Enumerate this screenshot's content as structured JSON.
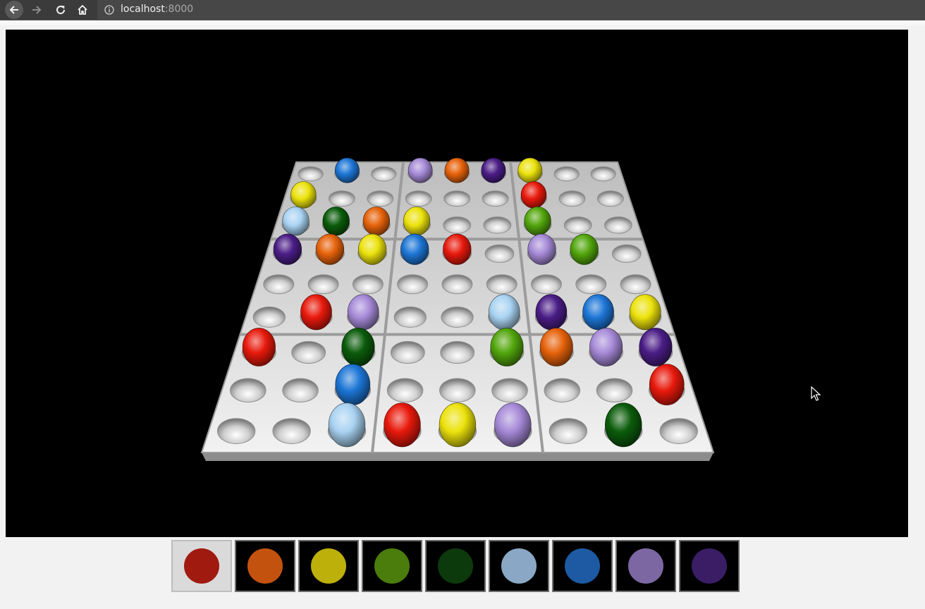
{
  "browser": {
    "url_host": "localhost",
    "url_port": ":8000"
  },
  "board": {
    "grid": [
      [
        "",
        "blue",
        "",
        "lavender",
        "orange",
        "purple",
        "yellow",
        "",
        ""
      ],
      [
        "yellow",
        "",
        "",
        "",
        "",
        "",
        "red",
        "",
        ""
      ],
      [
        "lightblue",
        "darkgreen",
        "orange",
        "yellow",
        "",
        "",
        "green",
        "",
        ""
      ],
      [
        "purple",
        "orange",
        "yellow",
        "blue",
        "red",
        "",
        "lavender",
        "green",
        ""
      ],
      [
        "",
        "",
        "",
        "",
        "",
        "",
        "",
        "",
        ""
      ],
      [
        "",
        "red",
        "lavender",
        "",
        "",
        "lightblue",
        "purple",
        "blue",
        "yellow"
      ],
      [
        "red",
        "",
        "darkgreen",
        "",
        "",
        "green",
        "orange",
        "lavender",
        "purple"
      ],
      [
        "",
        "",
        "blue",
        "",
        "",
        "",
        "",
        "",
        "red"
      ],
      [
        "",
        "",
        "lightblue",
        "red",
        "yellow",
        "lavender",
        "",
        "darkgreen",
        ""
      ]
    ],
    "marble_colors": {
      "red": "#e8190c",
      "orange": "#e6620a",
      "yellow": "#ece20c",
      "green": "#52a60c",
      "darkgreen": "#0b5c0b",
      "lightblue": "#a9d3f2",
      "blue": "#1d76d6",
      "lavender": "#a68ad8",
      "purple": "#4a1d86"
    }
  },
  "palette": {
    "selected_index": 0,
    "colors": [
      {
        "name": "red",
        "hex": "#a01a10"
      },
      {
        "name": "orange",
        "hex": "#c4520f"
      },
      {
        "name": "yellow",
        "hex": "#bdb00b"
      },
      {
        "name": "green",
        "hex": "#4a7d0c"
      },
      {
        "name": "darkgreen",
        "hex": "#0d3a0d"
      },
      {
        "name": "lightblue",
        "hex": "#8aa8c6"
      },
      {
        "name": "blue",
        "hex": "#1d5aa3"
      },
      {
        "name": "lavender",
        "hex": "#7d67a3"
      },
      {
        "name": "purple",
        "hex": "#3b1d66"
      }
    ]
  }
}
